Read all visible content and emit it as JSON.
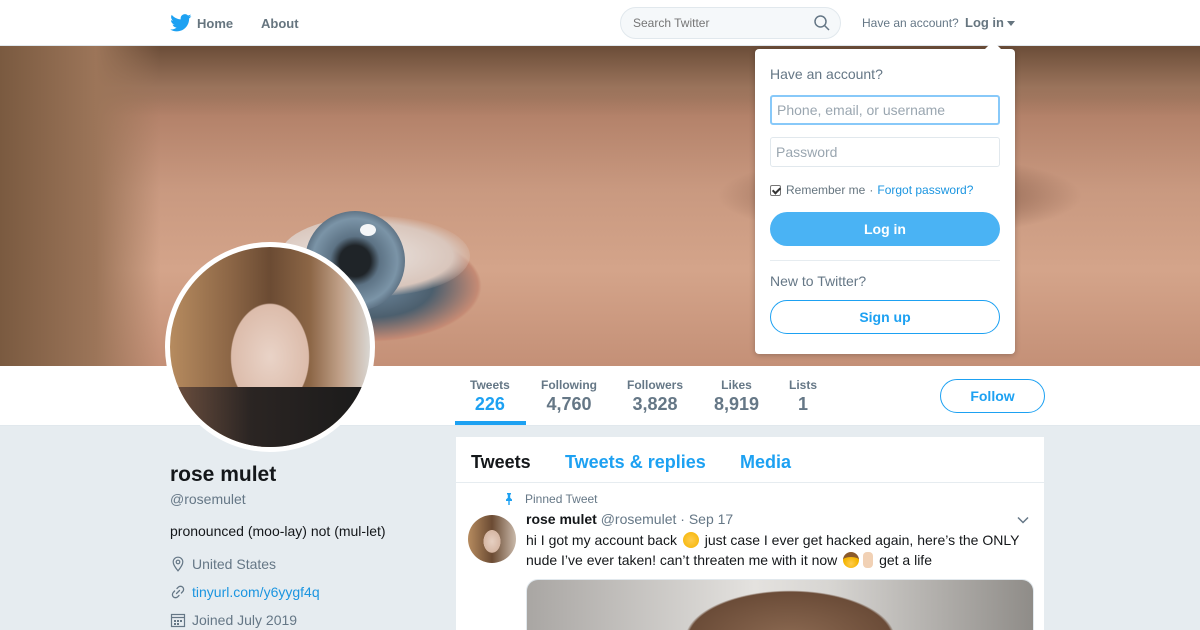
{
  "nav": {
    "home_label": "Home",
    "about_label": "About",
    "search_placeholder": "Search Twitter",
    "have_account": "Have an account?",
    "login_label": "Log in"
  },
  "profile": {
    "name": "rose mulet",
    "handle": "@rosemulet",
    "bio": "pronounced (moo-lay) not (mul-let)",
    "location": "United States",
    "link": "tinyurl.com/y6yygf4q",
    "joined": "Joined July 2019"
  },
  "stats": [
    {
      "label": "Tweets",
      "value": "226",
      "active": true
    },
    {
      "label": "Following",
      "value": "4,760"
    },
    {
      "label": "Followers",
      "value": "3,828"
    },
    {
      "label": "Likes",
      "value": "8,919"
    },
    {
      "label": "Lists",
      "value": "1"
    }
  ],
  "follow_label": "Follow",
  "timeline": {
    "tabs": [
      "Tweets",
      "Tweets & replies",
      "Media"
    ],
    "pinned_label": "Pinned Tweet",
    "tweet": {
      "name": "rose mulet",
      "handle": "@rosemulet",
      "date": "· Sep 17",
      "text_part1": "hi I got my account back",
      "text_part2": "just case I ever get hacked again, here’s the ONLY nude I’ve ever taken! can’t threaten me with it now",
      "text_part3": "get a life",
      "emojis": [
        "upside-down-face-emoji",
        "cowboy-face-emoji",
        "middle-finger-emoji"
      ]
    }
  },
  "login_dropdown": {
    "title": "Have an account?",
    "username_placeholder": "Phone, email, or username",
    "password_placeholder": "Password",
    "remember_label": "Remember me",
    "separator": "·",
    "forgot_label": "Forgot password?",
    "login_button": "Log in",
    "new_label": "New to Twitter?",
    "signup_button": "Sign up"
  },
  "colors": {
    "accent": "#1da1f2",
    "login_button_bg": "#4ab3f4",
    "page_bg": "#e6ecf0"
  }
}
